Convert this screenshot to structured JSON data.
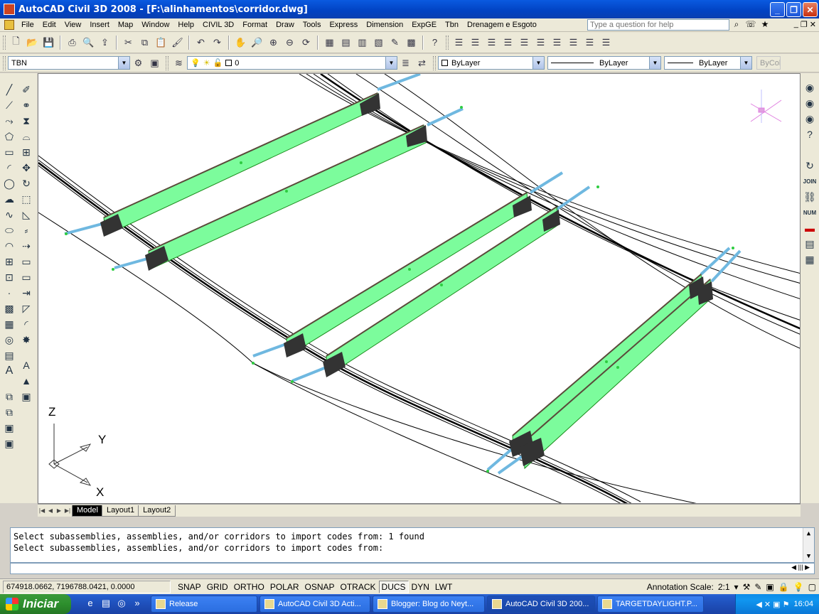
{
  "window": {
    "title": "AutoCAD Civil 3D 2008 - [F:\\alinhamentos\\corridor.dwg]"
  },
  "menu": [
    "File",
    "Edit",
    "View",
    "Insert",
    "Map",
    "Window",
    "Help",
    "CIVIL 3D",
    "Format",
    "Draw",
    "Tools",
    "Express",
    "Dimension",
    "ExpGE",
    "Tbn",
    "Drenagem e Esgoto"
  ],
  "help": {
    "placeholder": "Type a question for help"
  },
  "props": {
    "textstyle": "TBN",
    "layer": "0",
    "color": "ByLayer",
    "linetype": "ByLayer",
    "lineweight": "ByLayer",
    "plotstyle": "ByCol"
  },
  "ucs": {
    "z": "Z",
    "y": "Y",
    "x": "X"
  },
  "tabs": [
    "Model",
    "Layout1",
    "Layout2"
  ],
  "command": {
    "lines": [
      "Select subassemblies, assemblies, and/or corridors to import codes from: 1 found",
      "Select subassemblies, assemblies, and/or corridors to import codes from:"
    ]
  },
  "status": {
    "coords": "674918.0662, 7196788.0421, 0.0000",
    "buttons": [
      "SNAP",
      "GRID",
      "ORTHO",
      "POLAR",
      "OSNAP",
      "OTRACK",
      "DUCS",
      "DYN",
      "LWT"
    ],
    "annotation_label": "Annotation Scale:",
    "annotation_value": "2:1"
  },
  "taskbar": {
    "start": "Iniciar",
    "tasks": [
      "Release",
      "AutoCAD Civil 3D Acti...",
      "Blogger: Blog do Neyt...",
      "AutoCAD Civil 3D 200...",
      "TARGETDAYLIGHT.P..."
    ],
    "clock": "16:04"
  },
  "colors": {
    "corridor": "#7cfc9c",
    "road_blue": "#8ecae6",
    "asphalt": "#3a3a3a"
  }
}
